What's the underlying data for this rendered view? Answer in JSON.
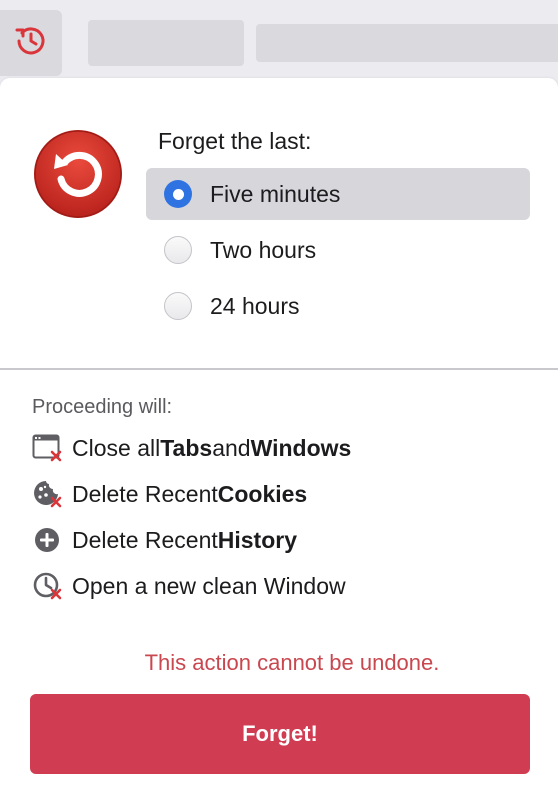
{
  "toolbar": {
    "history_icon": "history-rewind-icon"
  },
  "panel": {
    "app_icon": "forget-rewind-icon",
    "forget_label": "Forget the last:",
    "options": [
      {
        "label": "Five minutes",
        "selected": true
      },
      {
        "label": "Two hours",
        "selected": false
      },
      {
        "label": "24 hours",
        "selected": false
      }
    ],
    "proceeding_label": "Proceeding will:",
    "actions": [
      {
        "icon": "close-window-icon",
        "parts": [
          "Close all ",
          "Tabs",
          " and ",
          "Windows"
        ]
      },
      {
        "icon": "delete-cookie-icon",
        "parts": [
          "Delete Recent ",
          "Cookies"
        ]
      },
      {
        "icon": "delete-history-icon",
        "parts": [
          "Delete Recent ",
          "History"
        ]
      },
      {
        "icon": "new-window-icon",
        "parts": [
          "Open a new clean Window"
        ]
      }
    ],
    "warning": "This action cannot be undone.",
    "forget_button": "Forget!"
  },
  "colors": {
    "accent_red": "#d03d53",
    "warning_red": "#c9474f",
    "radio_blue": "#2f73e3"
  }
}
